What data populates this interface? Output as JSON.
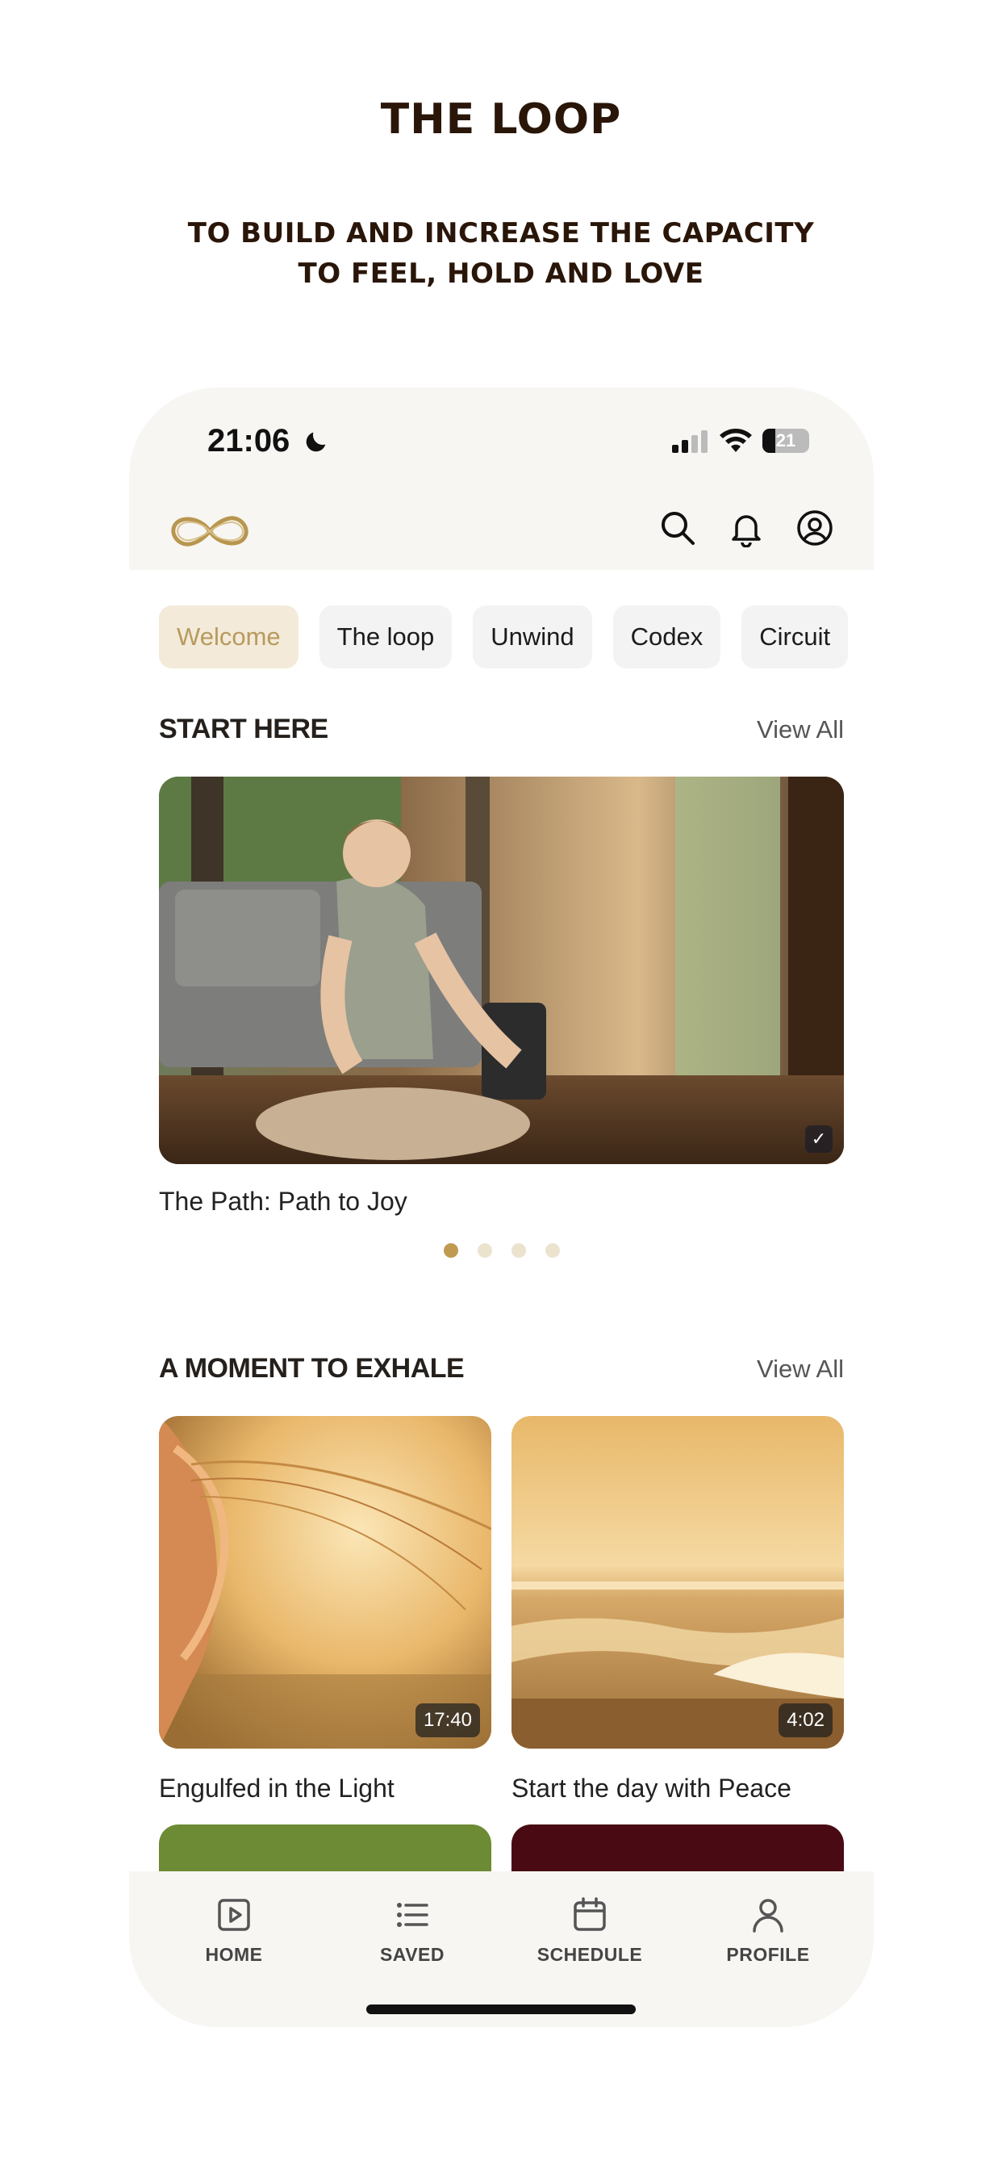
{
  "page": {
    "title": "THE LOOP",
    "subtitle_line1": "TO BUILD AND INCREASE THE CAPACITY",
    "subtitle_line2": "TO FEEL, HOLD AND LOVE"
  },
  "status_bar": {
    "time": "21:06",
    "battery": "21",
    "icons": [
      "moon-icon",
      "signal-icon",
      "wifi-icon",
      "battery-icon"
    ]
  },
  "header": {
    "logo": "infinity-logo",
    "icons": [
      "search-icon",
      "bell-icon",
      "profile-icon"
    ]
  },
  "chips": [
    {
      "label": "Welcome",
      "active": true
    },
    {
      "label": "The loop"
    },
    {
      "label": "Unwind"
    },
    {
      "label": "Codex"
    },
    {
      "label": "Circuit"
    }
  ],
  "start_here": {
    "title": "START HERE",
    "view_all": "View All",
    "hero_caption": "The Path: Path to Joy",
    "carousel_pages": 4,
    "carousel_active": 1
  },
  "exhale": {
    "title": "A MOMENT TO EXHALE",
    "view_all": "View All",
    "cards": [
      {
        "title": "Engulfed in the Light",
        "duration": "17:40"
      },
      {
        "title": "Start the day with Peace",
        "duration": "4:02"
      }
    ]
  },
  "tabbar": {
    "items": [
      {
        "label": "HOME",
        "icon": "play-square-icon"
      },
      {
        "label": "SAVED",
        "icon": "list-icon"
      },
      {
        "label": "SCHEDULE",
        "icon": "calendar-icon"
      },
      {
        "label": "PROFILE",
        "icon": "person-icon"
      }
    ]
  },
  "colors": {
    "accent": "#c19a52",
    "chip_active_bg": "#f3ead9",
    "title": "#2a1609"
  }
}
